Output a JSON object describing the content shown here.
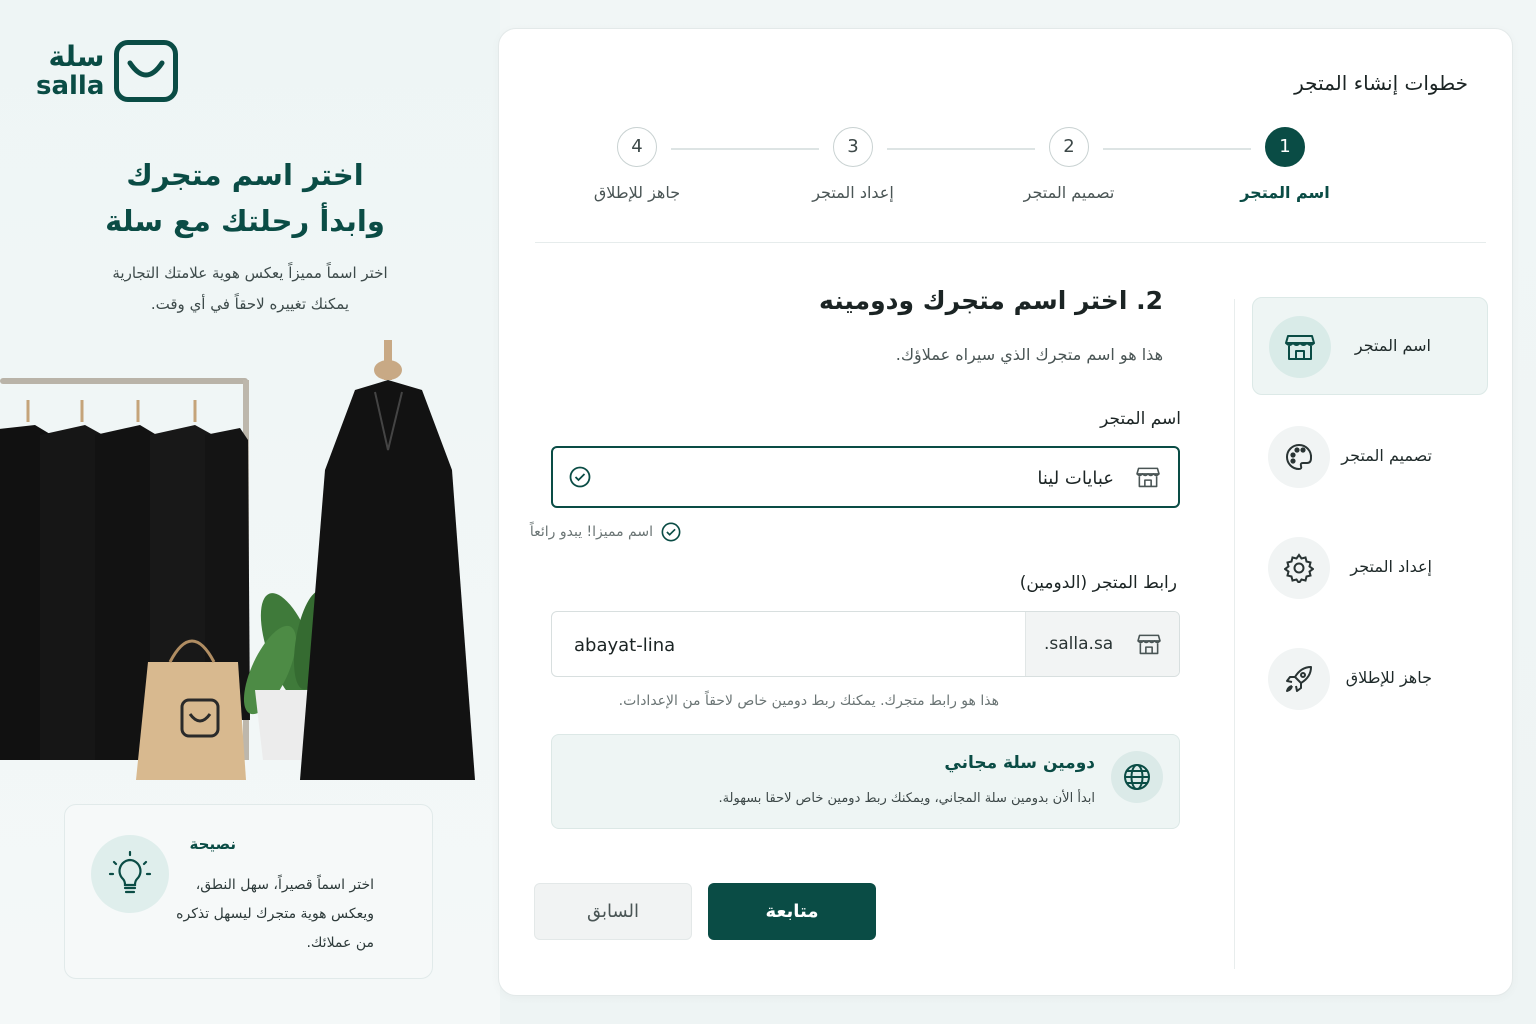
{
  "brand": {
    "name_ar": "سلة",
    "name_en": "salla",
    "color": "#0a4c45"
  },
  "hero": {
    "title_line1": "اختر اسم متجرك",
    "title_line2": "وابدأ رحلتك مع سلة",
    "subtitle_line1": "اختر اسماً مميزاً يعكس هوية علامتك التجارية",
    "subtitle_line2": "يمكنك تغييره لاحقاً في أي وقت."
  },
  "tip": {
    "title": "نصيحة",
    "line1": "اختر اسماً قصيراً، سهل النطق،",
    "line2": "ويعكس هوية متجرك ليسهل تذكره",
    "line3": "من عملائك."
  },
  "card": {
    "title": "خطوات إنشاء المتجر"
  },
  "steps": [
    {
      "number": "1",
      "label": "اسم المتجر",
      "active": true
    },
    {
      "number": "2",
      "label": "تصميم المتجر",
      "active": false
    },
    {
      "number": "3",
      "label": "إعداد المتجر",
      "active": false
    },
    {
      "number": "4",
      "label": "جاهز للإطلاق",
      "active": false
    }
  ],
  "side_nav": [
    {
      "label": "اسم المتجر",
      "icon": "store-icon",
      "active": true
    },
    {
      "label": "تصميم المتجر",
      "icon": "palette-icon",
      "active": false
    },
    {
      "label": "إعداد المتجر",
      "icon": "gear-icon",
      "active": false
    },
    {
      "label": "جاهز للإطلاق",
      "icon": "rocket-icon",
      "active": false
    }
  ],
  "form": {
    "heading": "2. اختر اسم متجرك ودومينه",
    "description": "هذا هو اسم متجرك الذي سيراه عملاؤك.",
    "store_name_label": "اسم المتجر",
    "store_name_value": "عبايات لينا",
    "store_name_ok": "اسم مميزا! يبدو رائعاً",
    "domain_label": "رابط المتجر (الدومين)",
    "domain_suffix": ".salla.sa",
    "domain_value": "abayat-lina",
    "domain_help": "هذا هو رابط متجرك. يمكنك ربط دومين خاص لاحقاً من الإعدادات.",
    "info_title": "دومين سلة مجاني",
    "info_body": "ابدأ الأن بدومين سلة المجاني، ويمكنك ربط دومين خاص لاحقا بسهولة."
  },
  "buttons": {
    "continue": "متابعة",
    "back": "السابق"
  }
}
